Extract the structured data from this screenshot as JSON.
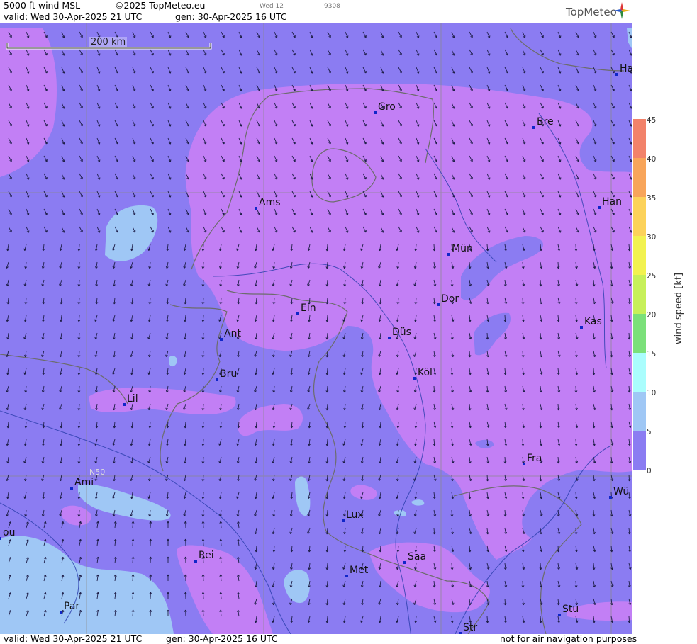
{
  "header": {
    "product": "5000 ft wind MSL",
    "copyright": "©2025 TopMeteo.eu",
    "tiny_day": "Wed 12",
    "tiny_code": "9308",
    "valid": "valid:  Wed  30-Apr-2025  21 UTC",
    "gen": "gen: 30-Apr-2025 16 UTC",
    "logo": "TopMeteo"
  },
  "footer": {
    "valid": "valid:  Wed  30-Apr-2025  21 UTC",
    "gen": "gen: 30-Apr-2025 16 UTC",
    "disclaimer": "not for air navigation purposes"
  },
  "scale": {
    "label": "200 km"
  },
  "grid_label": "N50",
  "cities": [
    {
      "name": "Gro"
    },
    {
      "name": "Bre"
    },
    {
      "name": "Ha"
    },
    {
      "name": "Ams"
    },
    {
      "name": "Han"
    },
    {
      "name": "Mün"
    },
    {
      "name": "Dor"
    },
    {
      "name": "Ein"
    },
    {
      "name": "Kas"
    },
    {
      "name": "Ant"
    },
    {
      "name": "Düs"
    },
    {
      "name": "Bru"
    },
    {
      "name": "Köl"
    },
    {
      "name": "Lil"
    },
    {
      "name": "Fra"
    },
    {
      "name": "Ami"
    },
    {
      "name": "Wü"
    },
    {
      "name": "Lux"
    },
    {
      "name": "Rei"
    },
    {
      "name": "Saa"
    },
    {
      "name": "Met"
    },
    {
      "name": "ou"
    },
    {
      "name": "Stu"
    },
    {
      "name": "Par"
    },
    {
      "name": "Str"
    }
  ],
  "legend": {
    "unit": "wind  speed  [kt]",
    "ticks": [
      "45",
      "40",
      "35",
      "30",
      "25",
      "20",
      "15",
      "10",
      "5",
      "0"
    ],
    "colors": [
      "#f2826a",
      "#f8a55a",
      "#fcd25a",
      "#f2f250",
      "#c7f05a",
      "#7be07a",
      "#aafdfd",
      "#9fc7f5",
      "#8b7cf2",
      "#c27ff5"
    ]
  },
  "colors": {
    "calm": "#c27ff5",
    "medium": "#8b7cf2",
    "strong": "#9fc7f5",
    "border": "#6c6c6c",
    "river": "#2d3fae"
  }
}
